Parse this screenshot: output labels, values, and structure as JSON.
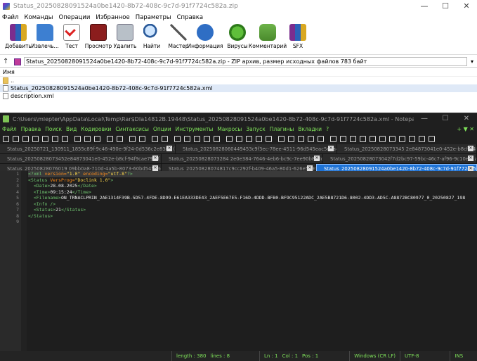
{
  "winrar": {
    "title": "Status_20250828091524a0be1420-8b72-408c-9c7d-91f7724c582a.zip",
    "menu": [
      "Файл",
      "Команды",
      "Операции",
      "Избранное",
      "Параметры",
      "Справка"
    ],
    "toolbar": [
      "Добавить",
      "Извлечь...",
      "Тест",
      "Просмотр",
      "Удалить",
      "Найти",
      "Мастер",
      "Информация",
      "Вирусы",
      "Комментарий",
      "SFX"
    ],
    "toolbar_icons": [
      "archive-add-icon",
      "extract-folder-icon",
      "test-icon",
      "view-book-icon",
      "delete-icon",
      "find-icon",
      "wizard-icon",
      "info-icon",
      "virus-icon",
      "comment-icon",
      "sfx-icon"
    ],
    "address": "Status_20250828091524a0be1420-8b72-408c-9c7d-91f7724c582a.zip - ZIP архив, размер исходных файлов 783 байт",
    "column_name": "Имя",
    "files": [
      {
        "name": ".."
      },
      {
        "name": "Status_20250828091524a0be1420-8b72-408c-9c7d-91f7724c582a.xml"
      },
      {
        "name": "description.xml"
      }
    ]
  },
  "npp": {
    "title": "C:\\Users\\mlepter\\AppData\\Local\\Temp\\Rar$DIa14812B.19448\\Status_20250828091524a0be1420-8b72-408c-9c7d-91f7724c582a.xml - Notepad++",
    "menu": [
      "Файл",
      "Правка",
      "Поиск",
      "Вид",
      "Кодировки",
      "Синтаксисы",
      "Опции",
      "Инструменты",
      "Макросы",
      "Запуск",
      "Плагины",
      "Вкладки",
      "?"
    ],
    "menu_right": "+ ▼ ✕",
    "tabs_row1": [
      "Status_20250721_130911_1855c89f-9c46-490e-9f24-0d536c2e830d (1).xml",
      "Status_20250828060449453c9f3ec-78ee-4511-96d545eac5e8a4a8.xml",
      "Status_20250828073345 2e84873041e0-452e-b8cf-94f9cae79f9f.xml"
    ],
    "tabs_row2": [
      "Status_20250828073452e84873041e0-452e-b8cf-94f9cae79f9f.xml",
      "Status_20250828073284 2e0e384-7646-4eb6-bc9c-7ee90b8e3c22.xml",
      "Status_20250828073042f7d2bc97-59bc-46c7-af96-9c10e91a9b.xml"
    ],
    "tabs_row3": [
      "Status_20250828076019 09bb0a8-710d-4a5b-8073-60bd54503c03.xml",
      "Status_20250828074817c9cc292f-b409-46a5-80d1-626e559f74c0.xml",
      "Status_20250828091524a0be1420-8b72-408c-9c7d-91f7724c582a.xml"
    ],
    "line_numbers": [
      "1",
      "2",
      "3",
      "4",
      "5",
      "6",
      "7",
      "8",
      "9"
    ],
    "code": {
      "l1_tag": "<?xml",
      "l1_a1": " version=",
      "l1_v1": "\"1.0\"",
      "l1_a2": " encoding=",
      "l1_v2": "\"utf-8\"",
      "l1_end": "?>",
      "l2_tag": "<Status",
      "l2_a": " VersProg=",
      "l2_v": "\"Doclink 1.0\"",
      "l2_end": ">",
      "l3_open": "<Date>",
      "l3_text": "28.08.2025",
      "l3_close": "</Date>",
      "l4_open": "<Time>",
      "l4_text": "09:15:24",
      "l4_close": "</Time>",
      "l5_open": "<Filename>",
      "l5_text": "ON_TRNACLPRIN_2AE1314F39B-5D57-4FDE-8D99-E61EA333DE43_2AEF5E67E5-F16D-4DDD-BFB0-BF9C95122ADC_2AE5B8721D6-8002-4DD3-AD5C-A8872BC80977_0_20250827_198",
      "l6": "<Info />",
      "l7_open": "<Status>",
      "l7_text": "21",
      "l7_close": "</Status>",
      "l8": "</Status>"
    },
    "status": {
      "length": "length : 380",
      "lines": "lines : 8",
      "ln": "Ln : 1",
      "col": "Col : 1",
      "pos": "Pos : 1",
      "eol": "Windows (CR LF)",
      "enc": "UTF-8",
      "ins": "INS"
    }
  }
}
